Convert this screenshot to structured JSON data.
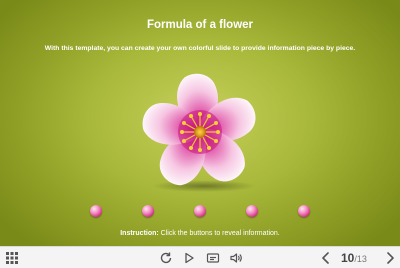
{
  "slide": {
    "title": "Formula of a flower",
    "subtitle": "With this template, you can create your own colorful slide to provide information piece by piece.",
    "instruction_label": "Instruction:",
    "instruction_text": " Click the buttons to reveal information.",
    "background_color": "#a8b83a",
    "flower_icon": "pink-flower-illustration",
    "reveal_buttons_count": 5,
    "reveal_button_color": "#e0509f"
  },
  "toolbar": {
    "menu_icon": "grid-menu-icon",
    "replay_icon": "replay-icon",
    "play_icon": "play-icon",
    "subtitles_icon": "subtitles-icon",
    "volume_icon": "volume-icon",
    "prev_icon": "chevron-left-icon",
    "next_icon": "chevron-right-icon",
    "current_slide": "10",
    "total_slides": "/13"
  }
}
